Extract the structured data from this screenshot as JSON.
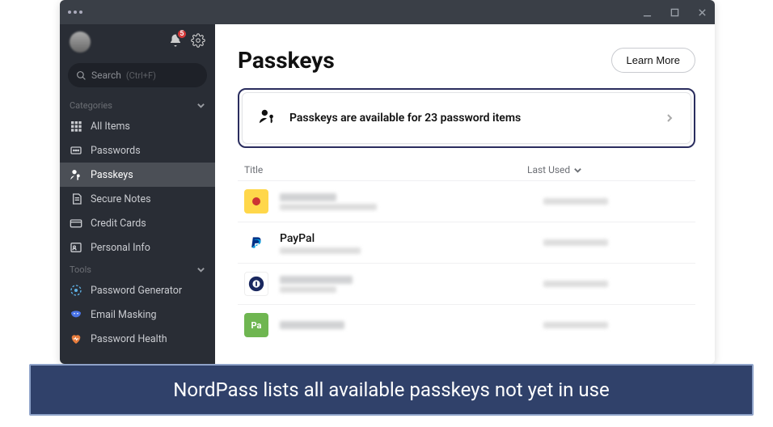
{
  "notifications": {
    "count": "5"
  },
  "search": {
    "label": "Search",
    "hint": "(Ctrl+F)"
  },
  "sidebar": {
    "categories_label": "Categories",
    "tools_label": "Tools",
    "items": [
      {
        "label": "All Items"
      },
      {
        "label": "Passwords"
      },
      {
        "label": "Passkeys"
      },
      {
        "label": "Secure Notes"
      },
      {
        "label": "Credit Cards"
      },
      {
        "label": "Personal Info"
      }
    ],
    "tools": [
      {
        "label": "Password Generator"
      },
      {
        "label": "Email Masking"
      },
      {
        "label": "Password Health"
      }
    ]
  },
  "main": {
    "title": "Passkeys",
    "learn_more": "Learn More",
    "banner_text": "Passkeys are available for 23 password items",
    "columns": {
      "title": "Title",
      "last_used": "Last Used"
    },
    "rows": [
      {
        "title": "",
        "subtitle": "",
        "last": ""
      },
      {
        "title": "PayPal",
        "subtitle": "",
        "last": ""
      },
      {
        "title": "",
        "subtitle": "",
        "last": ""
      },
      {
        "title": "",
        "subtitle": "",
        "last": ""
      }
    ]
  },
  "caption": "NordPass lists all available passkeys not yet in use"
}
